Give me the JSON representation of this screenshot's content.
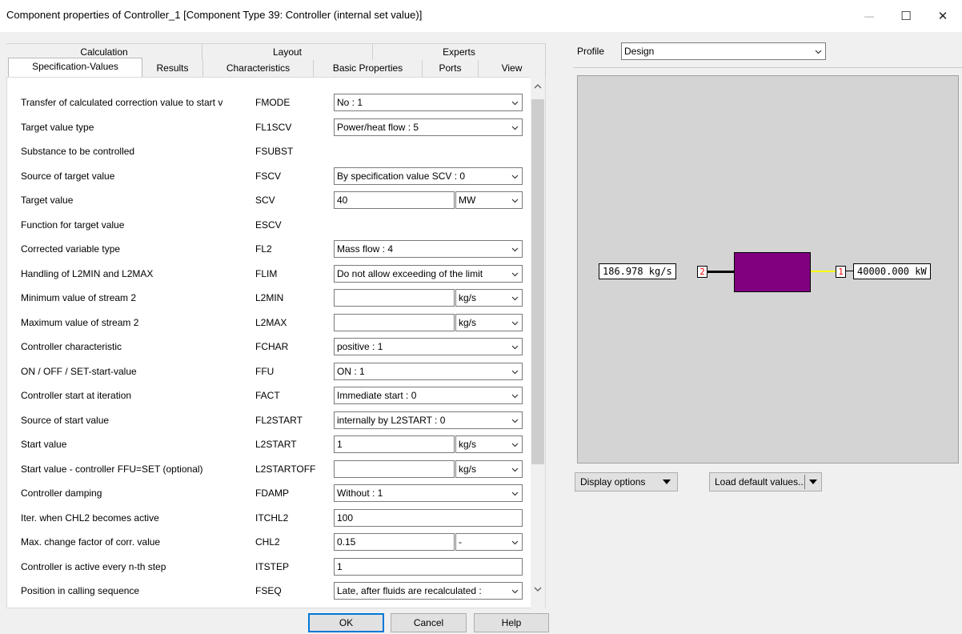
{
  "window": {
    "title": "Component properties of Controller_1  [Component Type 39: Controller (internal set value)]",
    "minimize_glyph": "—",
    "maximize_glyph": "☐",
    "close_glyph": "✕"
  },
  "tabs_top": [
    "Calculation",
    "Layout",
    "Experts"
  ],
  "tabs_bottom": [
    "Specification-Values",
    "Results",
    "Characteristics",
    "Basic Properties",
    "Ports",
    "View"
  ],
  "active_tab": "Specification-Values",
  "rows": [
    {
      "label": "Transfer of calculated correction value to start v",
      "code": "FMODE",
      "kind": "select",
      "value": "No : 1"
    },
    {
      "label": "Target value type",
      "code": "FL1SCV",
      "kind": "select",
      "value": "Power/heat flow : 5"
    },
    {
      "label": "Substance to be controlled",
      "code": "FSUBST",
      "kind": "none"
    },
    {
      "label": "Source of target value",
      "code": "FSCV",
      "kind": "select",
      "value": "By specification value SCV : 0"
    },
    {
      "label": "Target value",
      "code": "SCV",
      "kind": "unit",
      "value": "40",
      "unit": "MW"
    },
    {
      "label": "Function for target value",
      "code": "ESCV",
      "kind": "none"
    },
    {
      "label": "Corrected variable type",
      "code": "FL2",
      "kind": "select",
      "value": "Mass flow : 4"
    },
    {
      "label": "Handling of L2MIN and L2MAX",
      "code": "FLIM",
      "kind": "select",
      "value": "Do not allow exceeding of the limit"
    },
    {
      "label": "Minimum value of stream 2",
      "code": "L2MIN",
      "kind": "unit",
      "value": "",
      "unit": "kg/s"
    },
    {
      "label": "Maximum value of stream 2",
      "code": "L2MAX",
      "kind": "unit",
      "value": "",
      "unit": "kg/s"
    },
    {
      "label": "Controller characteristic",
      "code": "FCHAR",
      "kind": "select",
      "value": "positive : 1"
    },
    {
      "label": "ON / OFF / SET-start-value",
      "code": "FFU",
      "kind": "select",
      "value": "ON : 1"
    },
    {
      "label": "Controller start at iteration",
      "code": "FACT",
      "kind": "select",
      "value": "Immediate start : 0"
    },
    {
      "label": "Source of start value",
      "code": "FL2START",
      "kind": "select",
      "value": "internally by L2START : 0"
    },
    {
      "label": "Start value",
      "code": "L2START",
      "kind": "unit",
      "value": "1",
      "unit": "kg/s"
    },
    {
      "label": "Start value - controller FFU=SET (optional)",
      "code": "L2STARTOFF",
      "kind": "unit",
      "value": "",
      "unit": "kg/s"
    },
    {
      "label": "Controller damping",
      "code": "FDAMP",
      "kind": "select",
      "value": "Without : 1"
    },
    {
      "label": "Iter. when CHL2 becomes active",
      "code": "ITCHL2",
      "kind": "text",
      "value": "100"
    },
    {
      "label": "Max. change factor of corr. value",
      "code": "CHL2",
      "kind": "unit",
      "value": "0.15",
      "unit": "-"
    },
    {
      "label": "Controller is active every n-th step",
      "code": "ITSTEP",
      "kind": "text",
      "value": "1"
    },
    {
      "label": "Position in calling sequence",
      "code": "FSEQ",
      "kind": "select",
      "value": "Late, after fluids are recalculated :"
    }
  ],
  "buttons": {
    "ok": "OK",
    "cancel": "Cancel",
    "help": "Help"
  },
  "profile": {
    "label": "Profile",
    "value": "Design"
  },
  "diagram": {
    "left_value": "186.978 kg/s",
    "left_port": "2",
    "right_port": "1",
    "right_value": "40000.000 kW",
    "block_color": "#800080",
    "right_line_color": "#ffff00",
    "port_number_color": "#ff0000"
  },
  "display_options": "Display options",
  "load_defaults": "Load default values..."
}
